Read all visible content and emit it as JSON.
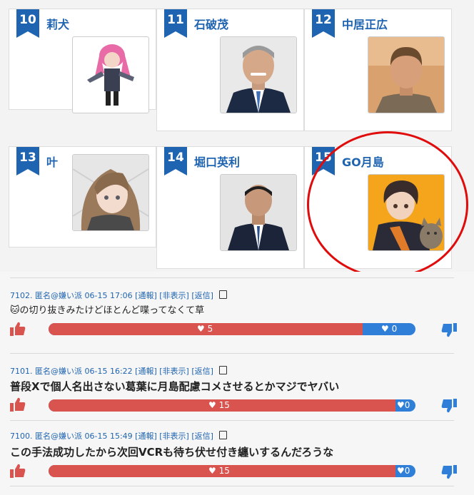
{
  "ranking": [
    {
      "rank": "10",
      "name": "莉犬"
    },
    {
      "rank": "11",
      "name": "石破茂"
    },
    {
      "rank": "12",
      "name": "中居正広"
    },
    {
      "rank": "13",
      "name": "叶"
    },
    {
      "rank": "14",
      "name": "堀口英利"
    },
    {
      "rank": "15",
      "name": "GO月島"
    }
  ],
  "comments": [
    {
      "number": "7102.",
      "author": "匿名@嫌い派",
      "datetime": "06-15 17:06",
      "report": "[通報]",
      "hide": "[非表示]",
      "reply": "[返信]",
      "text": "🐱の切り抜きみたけどほとんど喋ってなくて草",
      "good": "5",
      "bad": "0",
      "good_ratio": 1.0
    },
    {
      "number": "7101.",
      "author": "匿名@嫌い派",
      "datetime": "06-15 16:22",
      "report": "[通報]",
      "hide": "[非表示]",
      "reply": "[返信]",
      "text": "普段Xで個人名出さない葛葉に月島配慮コメさせるとかマジでヤバい",
      "good": "15",
      "bad": "0",
      "good_ratio": 1.0
    },
    {
      "number": "7100.",
      "author": "匿名@嫌い派",
      "datetime": "06-15 15:49",
      "report": "[通報]",
      "hide": "[非表示]",
      "reply": "[返信]",
      "text": "この手法成功したから次回VCRも待ち伏せ付き纏いするんだろうな",
      "good": "15",
      "bad": "0",
      "good_ratio": 1.0
    }
  ],
  "colors": {
    "accent_blue": "#1f64b0",
    "good_red": "#d9534f",
    "bad_blue": "#2f7ed8",
    "highlight_circle": "#e00c0c"
  }
}
